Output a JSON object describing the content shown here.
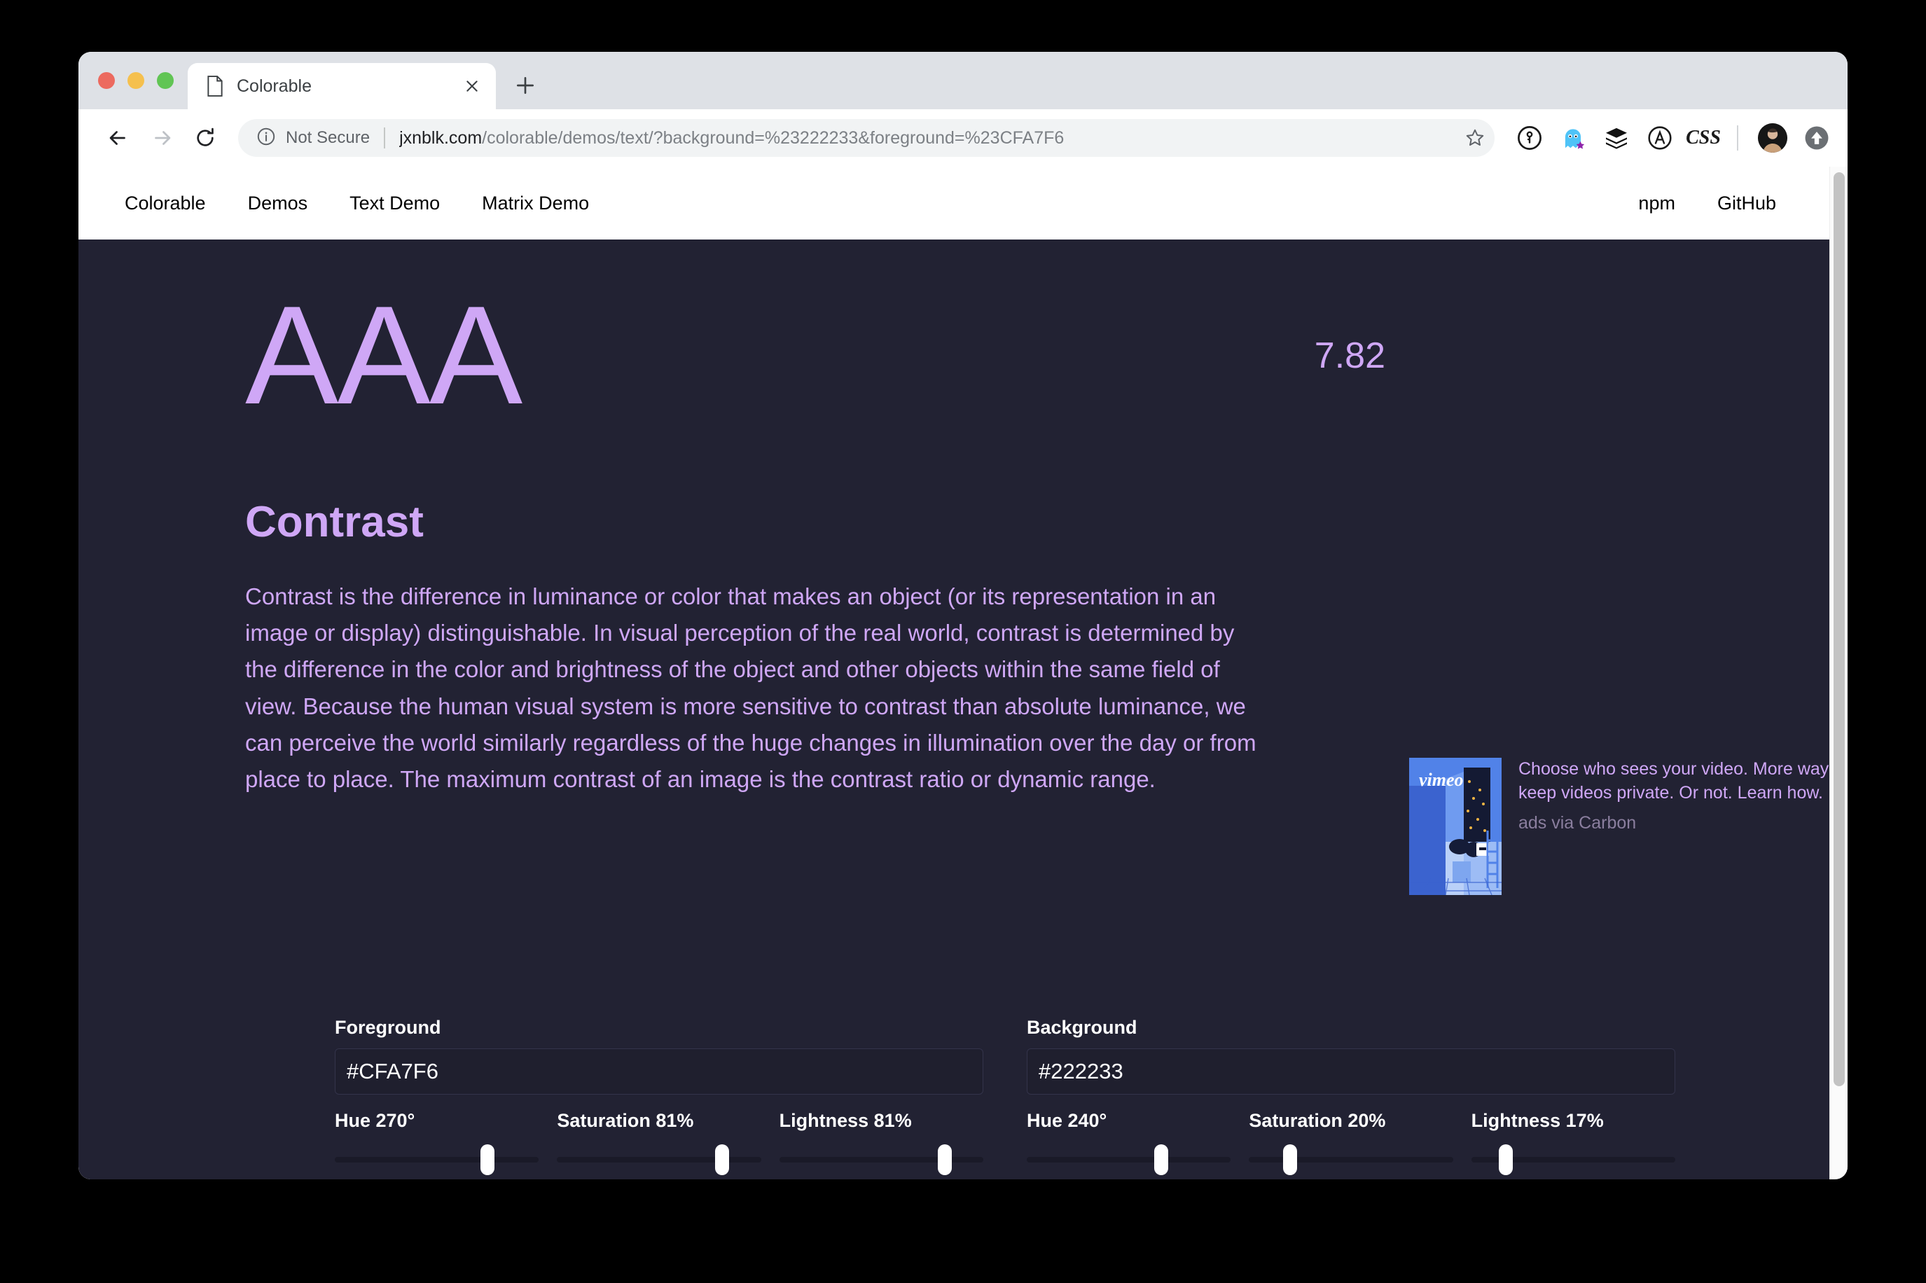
{
  "browser": {
    "tab": {
      "title": "Colorable",
      "favicon_icon": "page-icon",
      "close_icon": "close-icon"
    },
    "new_tab_label": "+",
    "nav": {
      "back_icon": "arrow-left-icon",
      "forward_icon": "arrow-right-icon",
      "reload_icon": "reload-icon"
    },
    "omnibox": {
      "info_icon": "info-circle-icon",
      "security_text": "Not Secure",
      "url_host": "jxnblk.com",
      "url_path": "/colorable/demos/text/?background=%23222233&foreground=%23CFA7F6",
      "bookmark_icon": "star-icon"
    },
    "extensions": [
      {
        "name": "1password-icon",
        "label": ""
      },
      {
        "name": "ghostery-icon",
        "label": ""
      },
      {
        "name": "layers-icon",
        "label": ""
      },
      {
        "name": "a-circle-icon",
        "label": ""
      },
      {
        "name": "css-icon",
        "label": "CSS"
      }
    ],
    "profile_icon": "avatar",
    "update_icon": "up-arrow-icon"
  },
  "site_nav": {
    "left_links": [
      {
        "label": "Colorable"
      },
      {
        "label": "Demos"
      },
      {
        "label": "Text Demo"
      },
      {
        "label": "Matrix Demo"
      }
    ],
    "right_links": [
      {
        "label": "npm"
      },
      {
        "label": "GitHub"
      }
    ]
  },
  "demo": {
    "rating": "AAA",
    "score": "7.82",
    "heading": "Contrast",
    "body": "Contrast is the difference in luminance or color that makes an object (or its representation in an image or display) distinguishable. In visual perception of the real world, contrast is determined by the difference in the color and brightness of the object and other objects within the same field of view. Because the human visual system is more sensitive to contrast than absolute luminance, we can perceive the world similarly regardless of the huge changes in illumination over the day or from place to place. The maximum contrast of an image is the contrast ratio or dynamic range.",
    "foreground_color": "#CFA7F6",
    "background_color": "#222233"
  },
  "ad": {
    "brand": "vimeo",
    "text": "Choose who sees your video. More ways to keep videos private. Or not. Learn how.",
    "via": "ads via Carbon"
  },
  "controls": {
    "foreground": {
      "label": "Foreground",
      "value": "#CFA7F6",
      "placeholder": "#CFA7F6",
      "sliders": [
        {
          "name": "hue",
          "label": "Hue 270°",
          "percent": 75
        },
        {
          "name": "saturation",
          "label": "Saturation 81%",
          "percent": 81
        },
        {
          "name": "lightness",
          "label": "Lightness 81%",
          "percent": 81
        }
      ]
    },
    "background": {
      "label": "Background",
      "value": "#222233",
      "placeholder": "#222233",
      "sliders": [
        {
          "name": "hue",
          "label": "Hue 240°",
          "percent": 66
        },
        {
          "name": "saturation",
          "label": "Saturation 20%",
          "percent": 20
        },
        {
          "name": "lightness",
          "label": "Lightness 17%",
          "percent": 17
        }
      ]
    }
  }
}
